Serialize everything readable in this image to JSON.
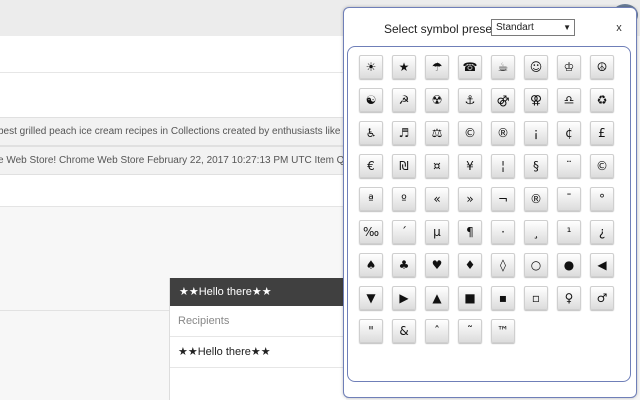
{
  "background": {
    "strip1_text": "best grilled peach ice cream recipes in Collections created by enthusiasts like you",
    "strip2_text": "e Web Store! Chrome Web Store February 22, 2017 10:27:13 PM UTC Item Qua",
    "compose": {
      "header_title": "★★Hello there★★",
      "recipients_placeholder": "Recipients",
      "subject_value": "★★Hello there★★"
    }
  },
  "popup": {
    "preset_label": "Select symbol preset:",
    "preset_selected": "Standart",
    "close_label": "x",
    "symbols": [
      "☀",
      "★",
      "☂",
      "☎",
      "☕",
      "☺",
      "♔",
      "☮",
      "☯",
      "☭",
      "☢",
      "⚓",
      "⚣",
      "⚢",
      "♎",
      "♻",
      "♿",
      "♬",
      "⚖",
      "©",
      "®",
      "¡",
      "¢",
      "£",
      "€",
      "₪",
      "¤",
      "¥",
      "¦",
      "§",
      "¨",
      "©",
      "ª",
      "º",
      "«",
      "»",
      "¬",
      "®",
      "¯",
      "°",
      "‰",
      "´",
      "µ",
      "¶",
      "·",
      "¸",
      "¹",
      "¿",
      "♠",
      "♣",
      "♥",
      "♦",
      "◊",
      "○",
      "●",
      "◀",
      "▼",
      "▶",
      "▲",
      "■",
      "▪",
      "▫",
      "♀",
      "♂",
      "\"",
      "&",
      "ˆ",
      "˜",
      "™"
    ]
  }
}
